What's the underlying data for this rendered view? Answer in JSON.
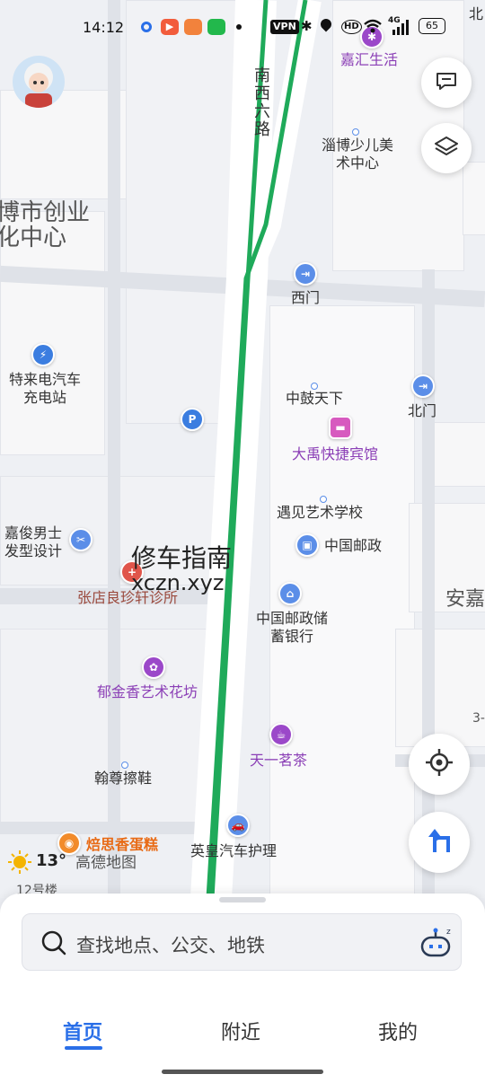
{
  "status_bar": {
    "time": "14:12",
    "vpn": "VPN",
    "hd": "HD",
    "network": "4G",
    "battery": "65"
  },
  "map": {
    "street_label": "南西六路",
    "area_label_1": "博市创业",
    "area_label_2": "化中心",
    "edge_label_north": "北",
    "edge_label_an": "安嘉",
    "edge_label_3": "3-",
    "road_label_12": "12号楼",
    "pois": {
      "jiahui": "嘉汇生活",
      "zibo_art": "淄博少儿美术中心",
      "ximen": "西门",
      "charging": "特来电汽车充电站",
      "zhonggu": "中鼓天下",
      "beimen": "北门",
      "dayu": "大禹快捷宾馆",
      "art_school": "遇见艺术学校",
      "jiajun": "嘉俊男士发型设计",
      "post": "中国邮政",
      "bank": "中国邮政储蓄银行",
      "clinic": "张店良珍轩诊所",
      "flower": "郁金香艺术花坊",
      "shoes": "翰尊擦鞋",
      "tea": "天一茗茶",
      "cake": "焙思香蛋糕",
      "car_care": "英皇汽车护理"
    },
    "watermark_line1": "修车指南",
    "watermark_line2": "xczn.xyz",
    "weather_temp": "13°",
    "logo_text": "高德地图"
  },
  "search": {
    "placeholder": "查找地点、公交、地铁"
  },
  "tabs": [
    {
      "label": "首页",
      "active": true
    },
    {
      "label": "附近",
      "active": false
    },
    {
      "label": "我的",
      "active": false
    }
  ],
  "colors": {
    "route": "#1faa5a",
    "accent": "#2a6fe8",
    "poi_purple": "#8b3fb6",
    "poi_orange": "#e86b16"
  }
}
